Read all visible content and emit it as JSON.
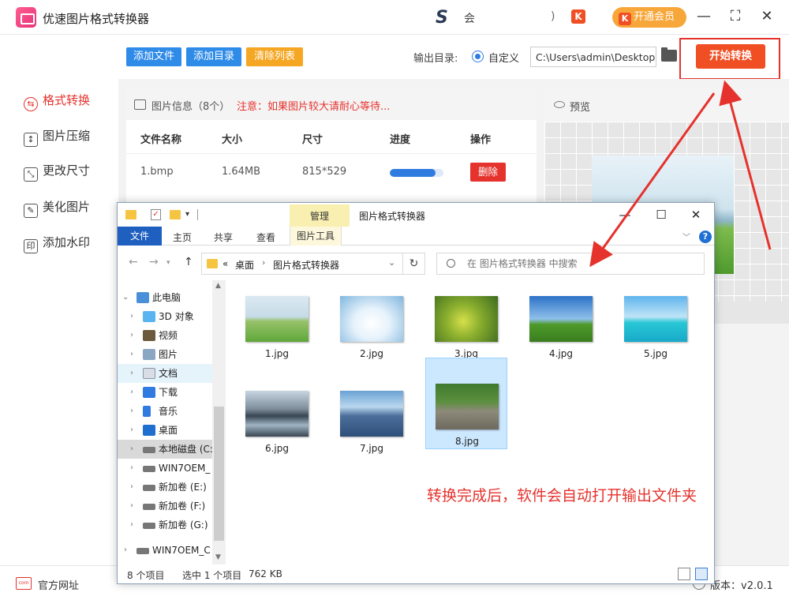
{
  "app": {
    "title": "优速图片格式转换器",
    "member_text": "会",
    "tb_glyph": ")",
    "k_icon": "K",
    "vip_label": "开通会员",
    "controls": {
      "minimize": "—",
      "maximize": "⛶",
      "close": "✕"
    }
  },
  "sidebar": {
    "items": [
      {
        "label": "格式转换",
        "icon": "format-convert-icon",
        "glyph": "⇆"
      },
      {
        "label": "图片压缩",
        "icon": "compress-icon",
        "glyph": "↕"
      },
      {
        "label": "更改尺寸",
        "icon": "resize-icon",
        "glyph": "⤡"
      },
      {
        "label": "美化图片",
        "icon": "beautify-icon",
        "glyph": "✎"
      },
      {
        "label": "添加水印",
        "icon": "watermark-icon",
        "glyph": "印"
      }
    ],
    "active_index": 0
  },
  "toolbar": {
    "add_file": "添加文件",
    "add_dir": "添加目录",
    "clear_list": "清除列表",
    "output_label": "输出目录:",
    "custom_label": "自定义",
    "output_path": "C:\\Users\\admin\\Desktop",
    "start": "开始转换"
  },
  "info": {
    "title": "图片信息（8个）",
    "note": "注意：如果图片较大请耐心等待...",
    "columns": [
      "文件名称",
      "大小",
      "尺寸",
      "进度",
      "操作"
    ],
    "rows": [
      {
        "name": "1.bmp",
        "size": "1.64MB",
        "dims": "815*529",
        "progress": 0.85,
        "action": "删除"
      }
    ]
  },
  "preview": {
    "title": "预览"
  },
  "status": {
    "site": "官方网址",
    "site_icon": "com",
    "version": "版本：v2.0.1"
  },
  "explorer": {
    "manage_tab": "管理",
    "title": "图片格式转换器",
    "ribbon": {
      "file": "文件",
      "home": "主页",
      "share": "共享",
      "view": "查看",
      "tools": "图片工具"
    },
    "address": {
      "prefix": "«",
      "seg1": "桌面",
      "seg2": "图片格式转换器"
    },
    "search_placeholder": "在 图片格式转换器 中搜索",
    "tree": [
      {
        "label": "此电脑",
        "icon": "computer-icon"
      },
      {
        "label": "3D 对象",
        "icon": "3d-objects-icon"
      },
      {
        "label": "视频",
        "icon": "video-icon"
      },
      {
        "label": "图片",
        "icon": "pictures-icon"
      },
      {
        "label": "文档",
        "icon": "documents-icon"
      },
      {
        "label": "下载",
        "icon": "download-icon"
      },
      {
        "label": "音乐",
        "icon": "music-icon"
      },
      {
        "label": "桌面",
        "icon": "desktop-icon"
      },
      {
        "label": "本地磁盘 (C:)",
        "icon": "drive-icon"
      },
      {
        "label": "WIN7OEM_",
        "icon": "drive-icon"
      },
      {
        "label": "新加卷 (E:)",
        "icon": "drive-icon"
      },
      {
        "label": "新加卷 (F:)",
        "icon": "drive-icon"
      },
      {
        "label": "新加卷 (G:)",
        "icon": "drive-icon"
      },
      {
        "label": "WIN7OEM_C",
        "icon": "drive-icon"
      }
    ],
    "files": [
      "1.jpg",
      "2.jpg",
      "3.jpg",
      "4.jpg",
      "5.jpg",
      "6.jpg",
      "7.jpg",
      "8.jpg"
    ],
    "selected_file_index": 7,
    "annotation": "转换完成后，软件会自动打开输出文件夹",
    "status": {
      "count": "8 个项目",
      "selected": "选中 1 个项目",
      "size": "762 KB"
    }
  }
}
